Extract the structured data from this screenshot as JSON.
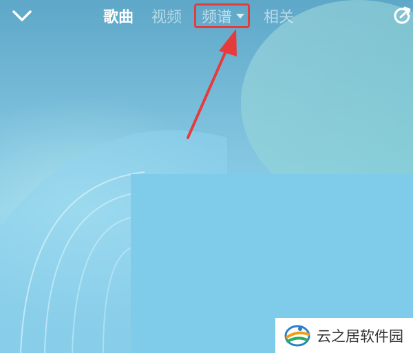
{
  "header": {
    "back_icon": "chevron-down-icon",
    "tabs": [
      {
        "label": "歌曲",
        "state": "active"
      },
      {
        "label": "视频",
        "state": "inactive"
      },
      {
        "label": "频谱",
        "state": "highlighted",
        "has_dropdown": true
      },
      {
        "label": "相关",
        "state": "inactive"
      }
    ],
    "share_icon": "share-icon"
  },
  "annotation": {
    "highlight_color": "#e53b3b",
    "arrow_color": "#e53b3b"
  },
  "watermark": {
    "text": "云之居软件园"
  },
  "colors": {
    "background_top": "#5ea7c8",
    "background_bottom": "#7fc6e2",
    "panel": "#7fcbea"
  }
}
